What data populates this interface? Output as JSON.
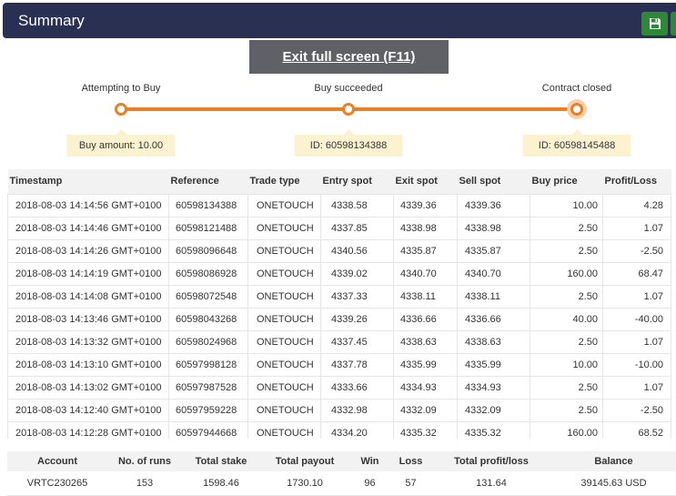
{
  "header": {
    "title": "Summary",
    "save_icon": "floppy-disk-icon"
  },
  "banner": {
    "text": "Exit full screen (F11)"
  },
  "timeline": {
    "steps": [
      {
        "label": "Attempting to Buy",
        "box": "Buy amount: 10.00"
      },
      {
        "label": "Buy succeeded",
        "box": "ID: 60598134388"
      },
      {
        "label": "Contract closed",
        "box": "ID: 60598145488"
      }
    ]
  },
  "colors": {
    "accent": "#e98024",
    "header_bg": "#2a3052",
    "profit": "#2e8836",
    "loss": "#cc2424"
  },
  "trades": {
    "headers": [
      "Timestamp",
      "Reference",
      "Trade type",
      "Entry spot",
      "Exit spot",
      "Sell spot",
      "Buy price",
      "Profit/Loss"
    ],
    "rows": [
      [
        "2018-08-03 14:14:56 GMT+0100",
        "60598134388",
        "ONETOUCH",
        "4338.58",
        "4339.36",
        "4339.36",
        "10.00",
        "4.28"
      ],
      [
        "2018-08-03 14:14:46 GMT+0100",
        "60598121488",
        "ONETOUCH",
        "4337.85",
        "4338.98",
        "4338.98",
        "2.50",
        "1.07"
      ],
      [
        "2018-08-03 14:14:26 GMT+0100",
        "60598096648",
        "ONETOUCH",
        "4340.56",
        "4335.87",
        "4335.87",
        "2.50",
        "-2.50"
      ],
      [
        "2018-08-03 14:14:19 GMT+0100",
        "60598086928",
        "ONETOUCH",
        "4339.02",
        "4340.70",
        "4340.70",
        "160.00",
        "68.47"
      ],
      [
        "2018-08-03 14:14:08 GMT+0100",
        "60598072548",
        "ONETOUCH",
        "4337.33",
        "4338.11",
        "4338.11",
        "2.50",
        "1.07"
      ],
      [
        "2018-08-03 14:13:46 GMT+0100",
        "60598043268",
        "ONETOUCH",
        "4339.26",
        "4336.66",
        "4336.66",
        "40.00",
        "-40.00"
      ],
      [
        "2018-08-03 14:13:32 GMT+0100",
        "60598024968",
        "ONETOUCH",
        "4337.45",
        "4338.63",
        "4338.63",
        "2.50",
        "1.07"
      ],
      [
        "2018-08-03 14:13:10 GMT+0100",
        "60597998128",
        "ONETOUCH",
        "4337.78",
        "4335.99",
        "4335.99",
        "10.00",
        "-10.00"
      ],
      [
        "2018-08-03 14:13:02 GMT+0100",
        "60597987528",
        "ONETOUCH",
        "4333.66",
        "4334.93",
        "4334.93",
        "2.50",
        "1.07"
      ],
      [
        "2018-08-03 14:12:40 GMT+0100",
        "60597959228",
        "ONETOUCH",
        "4332.98",
        "4332.09",
        "4332.09",
        "2.50",
        "-2.50"
      ],
      [
        "2018-08-03 14:12:28 GMT+0100",
        "60597944668",
        "ONETOUCH",
        "4334.20",
        "4335.32",
        "4335.32",
        "160.00",
        "68.52"
      ]
    ]
  },
  "summary": {
    "headers": [
      "Account",
      "No. of runs",
      "Total stake",
      "Total payout",
      "Win",
      "Loss",
      "Total profit/loss",
      "Balance"
    ],
    "values": [
      "VRTC230265",
      "153",
      "1598.46",
      "1730.10",
      "96",
      "57",
      "131.64",
      "39145.63 USD"
    ]
  }
}
